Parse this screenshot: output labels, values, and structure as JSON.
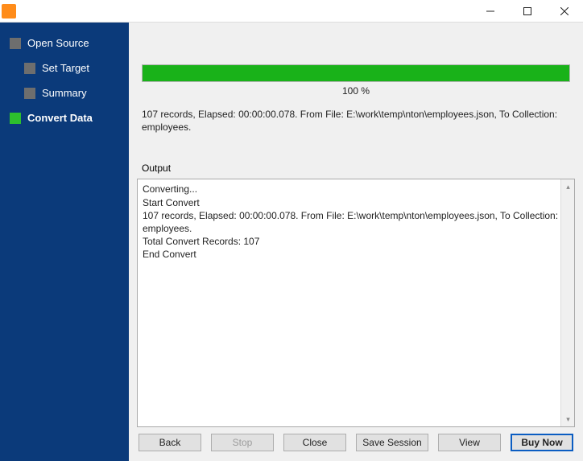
{
  "sidebar": {
    "items": [
      {
        "label": "Open Source",
        "active": false
      },
      {
        "label": "Set Target",
        "active": false
      },
      {
        "label": "Summary",
        "active": false
      },
      {
        "label": "Convert Data",
        "active": true
      }
    ]
  },
  "progress": {
    "percent_label": "100 %"
  },
  "status_line": "107 records,    Elapsed: 00:00:00.078.    From File: E:\\work\\temp\\nton\\employees.json,    To Collection: employees.",
  "output": {
    "label": "Output",
    "lines": [
      "Converting...",
      "Start Convert",
      "107 records,    Elapsed: 00:00:00.078.    From File: E:\\work\\temp\\nton\\employees.json,    To Collection: employees.",
      "Total Convert Records: 107",
      "End Convert"
    ]
  },
  "buttons": {
    "back": "Back",
    "stop": "Stop",
    "close": "Close",
    "save_session": "Save Session",
    "view": "View",
    "buy_now": "Buy Now"
  }
}
